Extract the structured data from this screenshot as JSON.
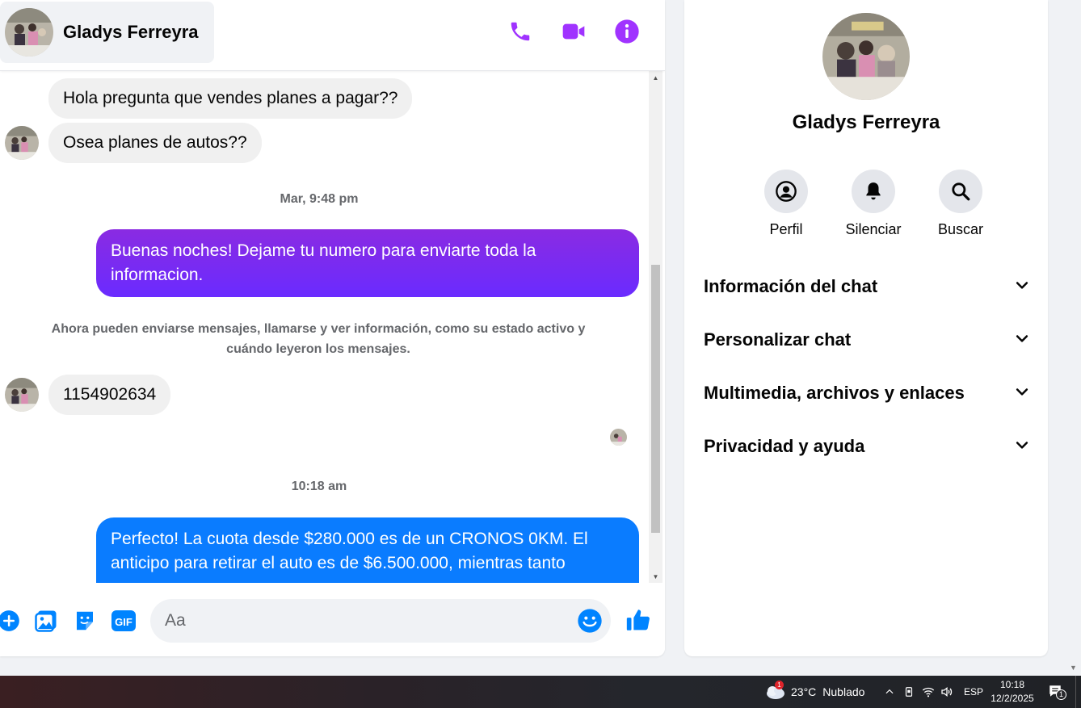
{
  "header": {
    "contact_name": "Gladys Ferreyra",
    "actions": [
      {
        "name": "call",
        "icon": "phone-icon"
      },
      {
        "name": "video",
        "icon": "video-camera-icon"
      },
      {
        "name": "info",
        "icon": "info-icon"
      }
    ],
    "accent_color": "#a033ff"
  },
  "messages": [
    {
      "type": "incoming",
      "text": "Hola pregunta que vendes planes a pagar??"
    },
    {
      "type": "incoming",
      "text": "Osea planes de autos??"
    },
    {
      "type": "timestamp",
      "text": "Mar, 9:48 pm"
    },
    {
      "type": "outgoing",
      "text": "Buenas noches! Dejame tu numero para enviarte toda la informacion."
    },
    {
      "type": "system",
      "text": "Ahora pueden enviarse mensajes, llamarse y ver información, como su estado activo y cuándo leyeron los mensajes."
    },
    {
      "type": "incoming",
      "text": "1154902634"
    },
    {
      "type": "timestamp",
      "text": "10:18 am"
    },
    {
      "type": "outgoing",
      "text": "Perfecto! La cuota desde $280.000 es de un CRONOS 0KM. El anticipo para retirar el auto es de $6.500.000, mientras tanto"
    }
  ],
  "composer": {
    "placeholder": "Aa",
    "icons": [
      "plus-icon",
      "photo-icon",
      "sticker-icon",
      "gif-icon"
    ],
    "gif_label": "GIF",
    "emoji_icon": "smiley-icon",
    "like_icon": "thumbs-up-icon"
  },
  "info_panel": {
    "name": "Gladys Ferreyra",
    "quick_actions": [
      {
        "label": "Perfil",
        "icon": "profile-icon"
      },
      {
        "label": "Silenciar",
        "icon": "bell-icon"
      },
      {
        "label": "Buscar",
        "icon": "search-icon"
      }
    ],
    "sections": [
      {
        "label": "Información del chat"
      },
      {
        "label": "Personalizar chat"
      },
      {
        "label": "Multimedia, archivos y enlaces"
      },
      {
        "label": "Privacidad y ayuda"
      }
    ]
  },
  "taskbar": {
    "weather_temp": "23°C",
    "weather_desc": "Nublado",
    "weather_badge": "1",
    "language": "ESP",
    "time": "10:18",
    "date": "12/2/2025",
    "notification_count": "1"
  },
  "colors": {
    "outgoing_gradient_top": "#8a2be2",
    "outgoing_gradient_bottom": "#6a2bff",
    "outgoing_blue": "#0a7cff",
    "messenger_blue": "#0084ff",
    "incoming_bg": "#f0f0f0"
  }
}
